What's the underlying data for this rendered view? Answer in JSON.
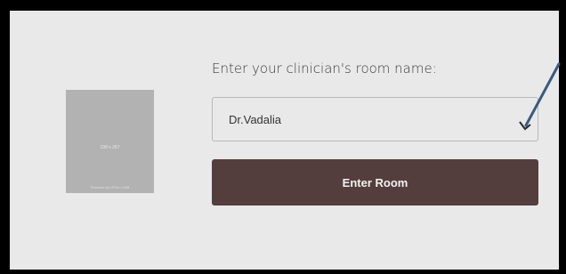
{
  "placeholder": {
    "dimensions": "198 x 267",
    "powered": "Powered by HTML.COM"
  },
  "form": {
    "prompt": "Enter your clinician's room name:",
    "room_value": "Dr.Vadalia",
    "button_label": "Enter Room"
  },
  "colors": {
    "button": "#543e3d",
    "annotation_arrow": "#3a5a80"
  }
}
